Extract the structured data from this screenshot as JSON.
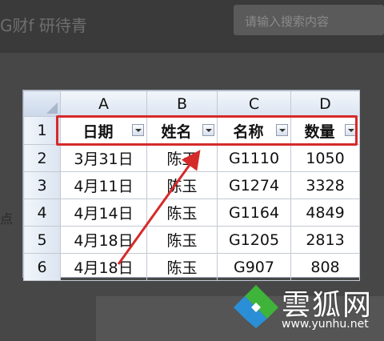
{
  "page": {
    "title": "G财f 研待青",
    "search_placeholder": "请输入搜索内容",
    "side_text": "点"
  },
  "sheet": {
    "columns": [
      "A",
      "B",
      "C",
      "D"
    ],
    "row_numbers": [
      "1",
      "2",
      "3",
      "4",
      "5",
      "6"
    ],
    "header": [
      "日期",
      "姓名",
      "名称",
      "数量"
    ],
    "rows": [
      [
        "3月31日",
        "陈玉",
        "G1110",
        "1050"
      ],
      [
        "4月11日",
        "陈玉",
        "G1274",
        "3328"
      ],
      [
        "4月14日",
        "陈玉",
        "G1164",
        "4849"
      ],
      [
        "4月18日",
        "陈玉",
        "G1205",
        "2813"
      ],
      [
        "4月18日",
        "陈玉",
        "G907",
        "808"
      ]
    ]
  },
  "annotation": {
    "highlight_color": "#d62a2a",
    "arrow_color": "#d62a2a"
  },
  "watermark": {
    "brand": "雲狐网",
    "url": "www.yunhu.net"
  }
}
